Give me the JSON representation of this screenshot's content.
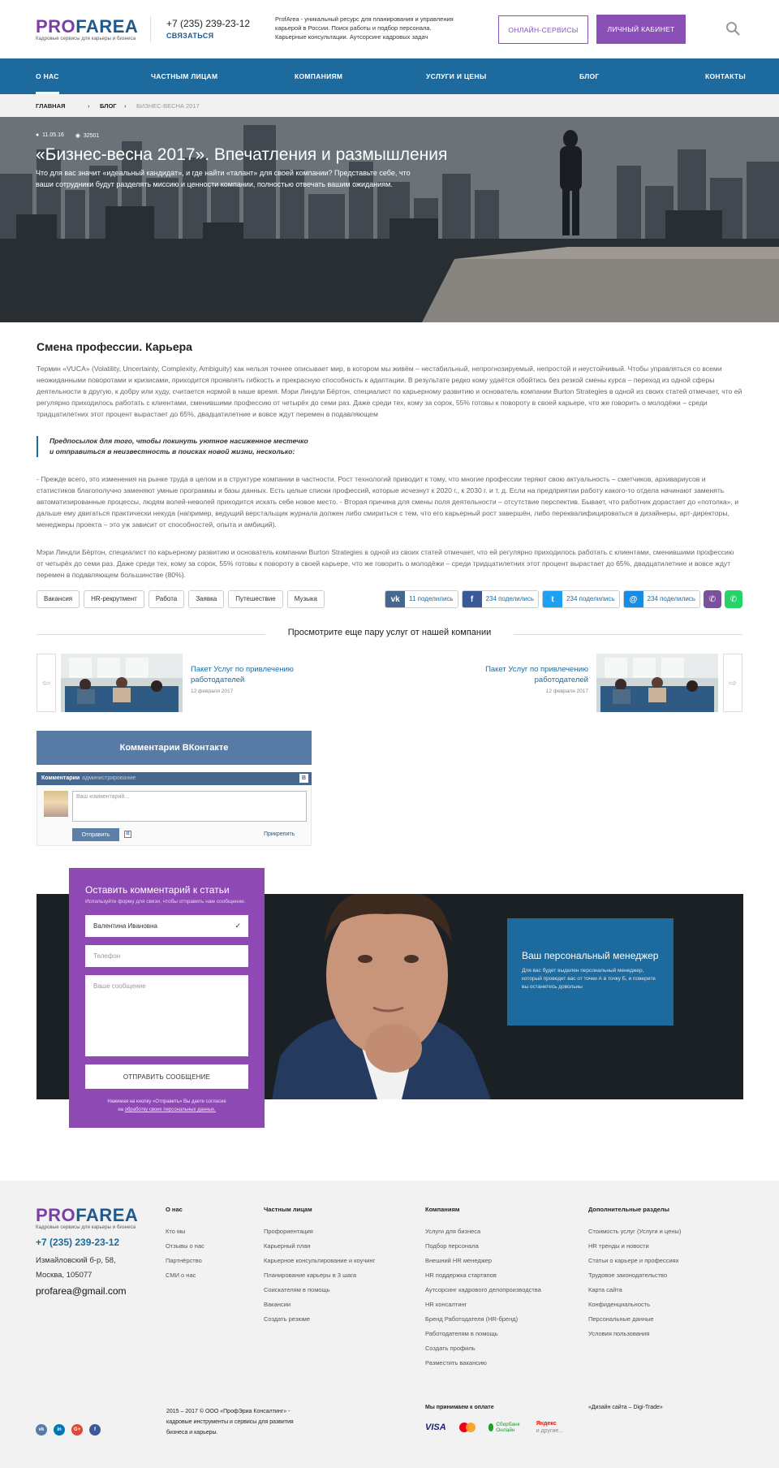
{
  "header": {
    "logo_pro": "PRO",
    "logo_area": "FAREA",
    "logo_sub": "Кадровые сервисы для карьеры и бизнеса",
    "phone": "+7 (235) 239-23-12",
    "callback": "Связаться",
    "description": "ProfArea - уникальный ресурс для планирования и управления карьерой в России. Поиск работы и подбор персонала. Карьерные консультации. Аутсорсинг кадровых задач",
    "btn_online": "Онлайн-сервисы",
    "btn_cabinet": "Личный кабинет",
    "search_icon": "search-icon"
  },
  "nav": {
    "items": [
      "О нас",
      "Частным лицам",
      "Компаниям",
      "Услуги и цены",
      "Блог",
      "Контакты"
    ]
  },
  "breadcrumb": {
    "home": "Главная",
    "blog": "Блог",
    "current": "Бизнес-весна 2017"
  },
  "hero": {
    "date": "11.05.16",
    "views": "32501",
    "title": "«Бизнес-весна 2017». Впечатления и размышления",
    "lead": "Что для вас значит «идеальный кандидат», и где найти «талант» для своей компании? Представьте себе, что ваши сотрудники будут разделять миссию и ценности компании, полностью отвечать вашим ожиданиям."
  },
  "article": {
    "heading": "Смена профессии. Карьера",
    "p1": "Термин «VUCA» (Volatility, Uncertainty, Complexity, Ambiguity) как нельзя точнее описывает мир, в котором мы живём – нестабильный, непрогнозируемый, непростой и неустойчивый. Чтобы управляться со всеми неожиданными поворотами и кризисами, приходится проявлять гибкость и прекрасную способность к адаптации. В результате редко кому удаётся обойтись без резкой смены курса – переход из одной сферы деятельности в другую, к добру или худу, считается нормой в наше время. Мэри Линдли Бёртон, специалист по карьерному развитию и основатель компании Burton Strategies в одной из своих статей отмечает, что ей регулярно приходилось работать с клиентами, сменившими профессию от четырёх до семи раз. Даже среди тех, кому за сорок, 55% готовы к повороту в своей карьере, что же говорить о молодёжи – среди тридцатилетних этот процент вырастает до 65%, двадцатилетние и вовсе ждут перемен в подавляющем",
    "quote_1": "Предпосылок для того, чтобы покинуть уютное насиженное местечко",
    "quote_2": "и отправиться в неизвестность в поисках новой жизни, несколько:",
    "p2": "- Прежде всего, это изменения на рынке труда в целом и в структуре компании в частности. Рост технологий приводит к тому, что многие профессии теряют свою актуальность – сметчиков, архивариусов и статистиков благополучно заменяют умные программы и базы данных. Есть целые списки профессий, которые исчезнут к 2020 г., к 2030 г. и т. д. Если на предприятии работу какого-то отдела начинают заменять автоматизированные процессы, людям волей-неволей приходится искать себе новое место. - Вторая причина для смены поля деятельности – отсутствие перспектив. Бывает, что работник дорастает до «потолка», и дальше ему двигаться практически некуда (например, ведущий верстальщик журнала должен либо смириться с тем, что его карьерный рост завершён, либо переквалифицироваться в дизайнеры, арт-директоры, менеджеры проекта – это уж зависит от способностей, опыта и амбиций).",
    "p3": "Мэри Линдли Бёртон, специалист по карьерному развитию и основатель компании Burton Strategies в одной из своих статей отмечает, что ей регулярно приходилось работать с клиентами, сменившими профессию от четырёх до семи раз. Даже среди тех, кому за сорок, 55% готовы к повороту в своей карьере, что же говорить о молодёжи – среди тридцатилетних этот процент вырастает до 65%, двадцатилетние и вовсе ждут перемен в подавляющем большинстве (80%).",
    "tags": [
      "Вакансия",
      "HR-рекрутмент",
      "Работа",
      "Заявка",
      "Путешествие",
      "Музыка"
    ],
    "shares": {
      "vk": "11 поделились",
      "fb": "234 поделились",
      "tw": "234 поделились",
      "mm": "234 поделились"
    }
  },
  "more": {
    "title": "Просмотрите еще пару услуг от нашей компании",
    "left": {
      "title": "Пакет Услуг по привлечению работодателей",
      "date": "12 февраля 2017"
    },
    "right": {
      "title": "Пакет Услуг по привлечению работодателей",
      "date": "12 февраля 2017"
    }
  },
  "vk": {
    "title": "Комментарии ВКонтакте",
    "bar": "Комментарии",
    "admin": "администрирование",
    "placeholder": "Ваш комментарий...",
    "send": "Отправить",
    "attach": "Прикрепить"
  },
  "form": {
    "title": "Оставить комментарий к статьи",
    "subtitle": "Используйте форму для связи, чтобы отправить нам сообщение.",
    "name_value": "Валентина Ивановна",
    "phone_placeholder": "Телефон",
    "message_placeholder": "Ваше сообщение",
    "send": "Отправить сообщение",
    "agree_1": "Нажимая на кнопку «Отправить» Вы даете согласие",
    "agree_2_prefix": "на",
    "agree_2_link": "обработку своих персональных данных."
  },
  "manager": {
    "title": "Ваш персональный менеджер",
    "text": "Для вас будет выделен персональный менеджер, который проведет вас от точки А в точку Б, и поверите вы останетесь довольны"
  },
  "footer": {
    "phone": "+7 (235) 239-23-12",
    "addr_1": "Измайловский б-р, 58,",
    "addr_2": "Москва, 105077",
    "email": "profarea@gmail.com",
    "col_about": {
      "title": "О нас",
      "links": [
        "Кто мы",
        "Отзывы о нас",
        "Партнёрство",
        "СМИ о нас"
      ]
    },
    "col_private": {
      "title": "Частным лицам",
      "links": [
        "Профориентация",
        "Карьерный план",
        "Карьерное консультирование и коучинг",
        "Планирование карьеры в 3 шага",
        "Соискателям в помощь",
        "Вакансии",
        "Создать резюме"
      ]
    },
    "col_company": {
      "title": "Компаниям",
      "links": [
        "Услуги для бизнеса",
        "Подбор персонала",
        "Внешний HR менеджер",
        "HR поддержка стартапов",
        "Аутсорсинг кадрового делопроизводства",
        "HR консалтинг",
        "Бренд Работодателя (HR-бренд)",
        "Работодателям в помощь",
        "Создать профиль",
        "Разместить вакансию"
      ]
    },
    "col_extra": {
      "title": "Дополнительные разделы",
      "links": [
        "Стоимость услуг (Услуги и цены)",
        "HR тренды и новости",
        "Статьи о карьере и профессиях",
        "Трудовое законодательство",
        "Карта сайта",
        "Конфиденциальность",
        "Персональные данные",
        "Условия пользования"
      ]
    },
    "copyright": "2015 – 2017 © ООО «ПрофЭриа Консалтинг» - кадровые инструменты и сервисы для развития бизнеса и карьеры.",
    "pay_title": "Мы принимаем к оплате",
    "pay_visa": "VISA",
    "pay_sber": "Сбербанк Онлайн",
    "pay_yandex": "Яндекс",
    "pay_other": "и другие...",
    "developer": "«Дизайн сайта – Digi-Trade»",
    "social": [
      "vk-icon",
      "linkedin-icon",
      "google-plus-icon",
      "facebook-icon"
    ]
  },
  "colors": {
    "brand_purple": "#8e49b4",
    "brand_blue": "#1d6a9e",
    "vk_blue": "#577ba5"
  }
}
